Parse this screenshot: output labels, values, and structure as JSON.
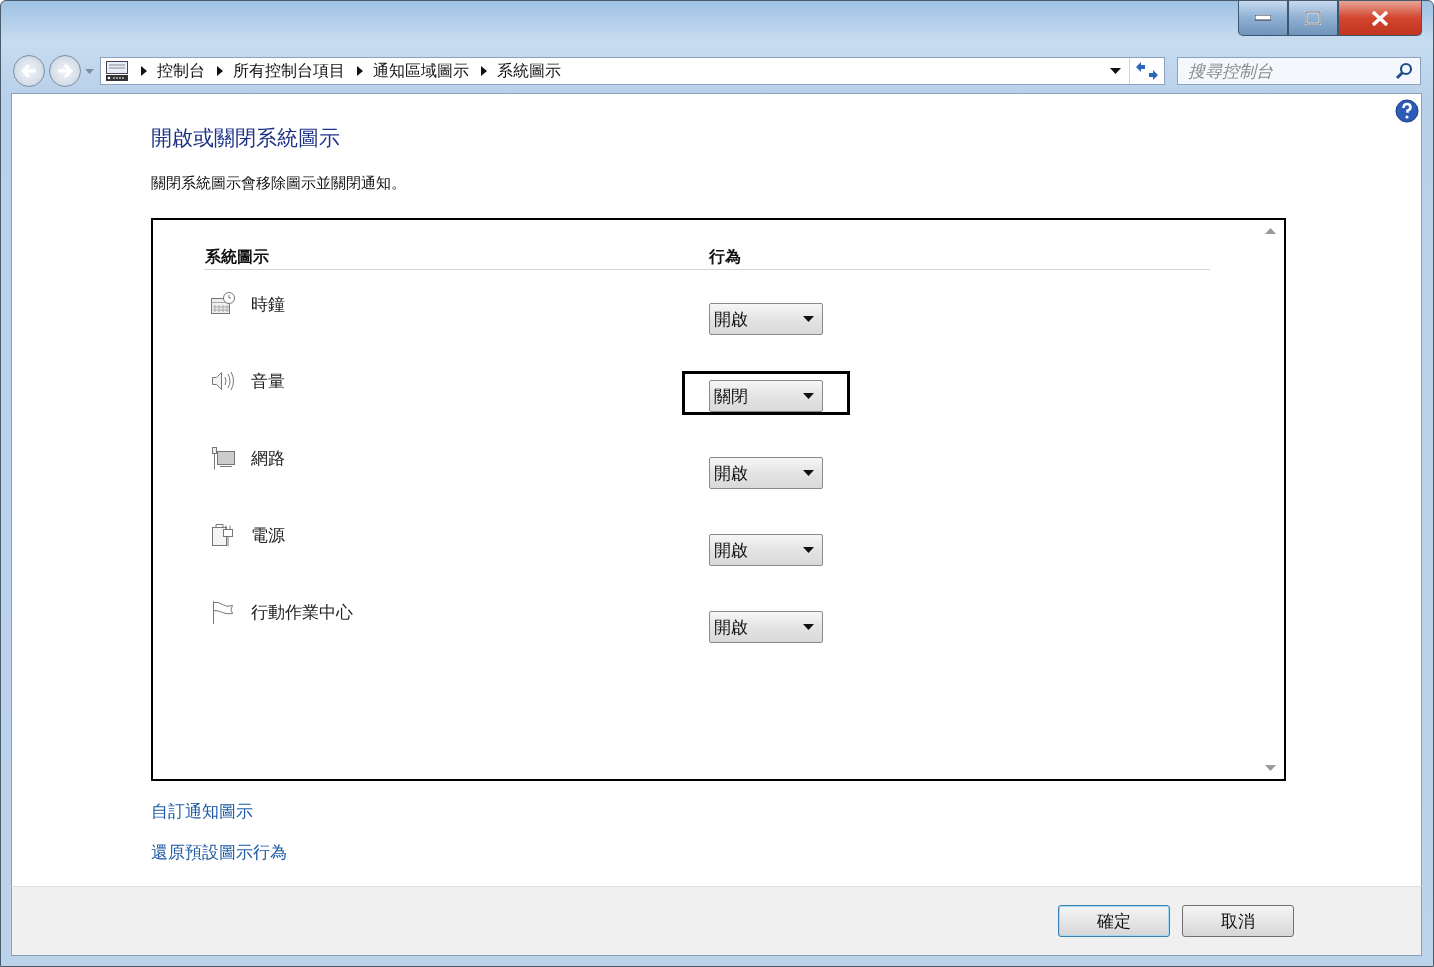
{
  "address_bar": {
    "breadcrumbs": [
      "控制台",
      "所有控制台項目",
      "通知區域圖示",
      "系統圖示"
    ]
  },
  "search": {
    "placeholder": "搜尋控制台"
  },
  "heading": "開啟或關閉系統圖示",
  "description": "關閉系統圖示會移除圖示並關閉通知。",
  "table": {
    "columns": [
      "系統圖示",
      "行為"
    ],
    "rows": [
      {
        "kind": "clock",
        "name": "時鐘",
        "behavior": "開啟",
        "highlighted": false
      },
      {
        "kind": "volume",
        "name": "音量",
        "behavior": "關閉",
        "highlighted": true
      },
      {
        "kind": "network",
        "name": "網路",
        "behavior": "開啟",
        "highlighted": false
      },
      {
        "kind": "power",
        "name": "電源",
        "behavior": "開啟",
        "highlighted": false
      },
      {
        "kind": "action-center",
        "name": "行動作業中心",
        "behavior": "開啟",
        "highlighted": false
      }
    ]
  },
  "links": [
    "自訂通知圖示",
    "還原預設圖示行為"
  ],
  "buttons": [
    {
      "label": "確定",
      "default": true
    },
    {
      "label": "取消",
      "default": false
    }
  ]
}
